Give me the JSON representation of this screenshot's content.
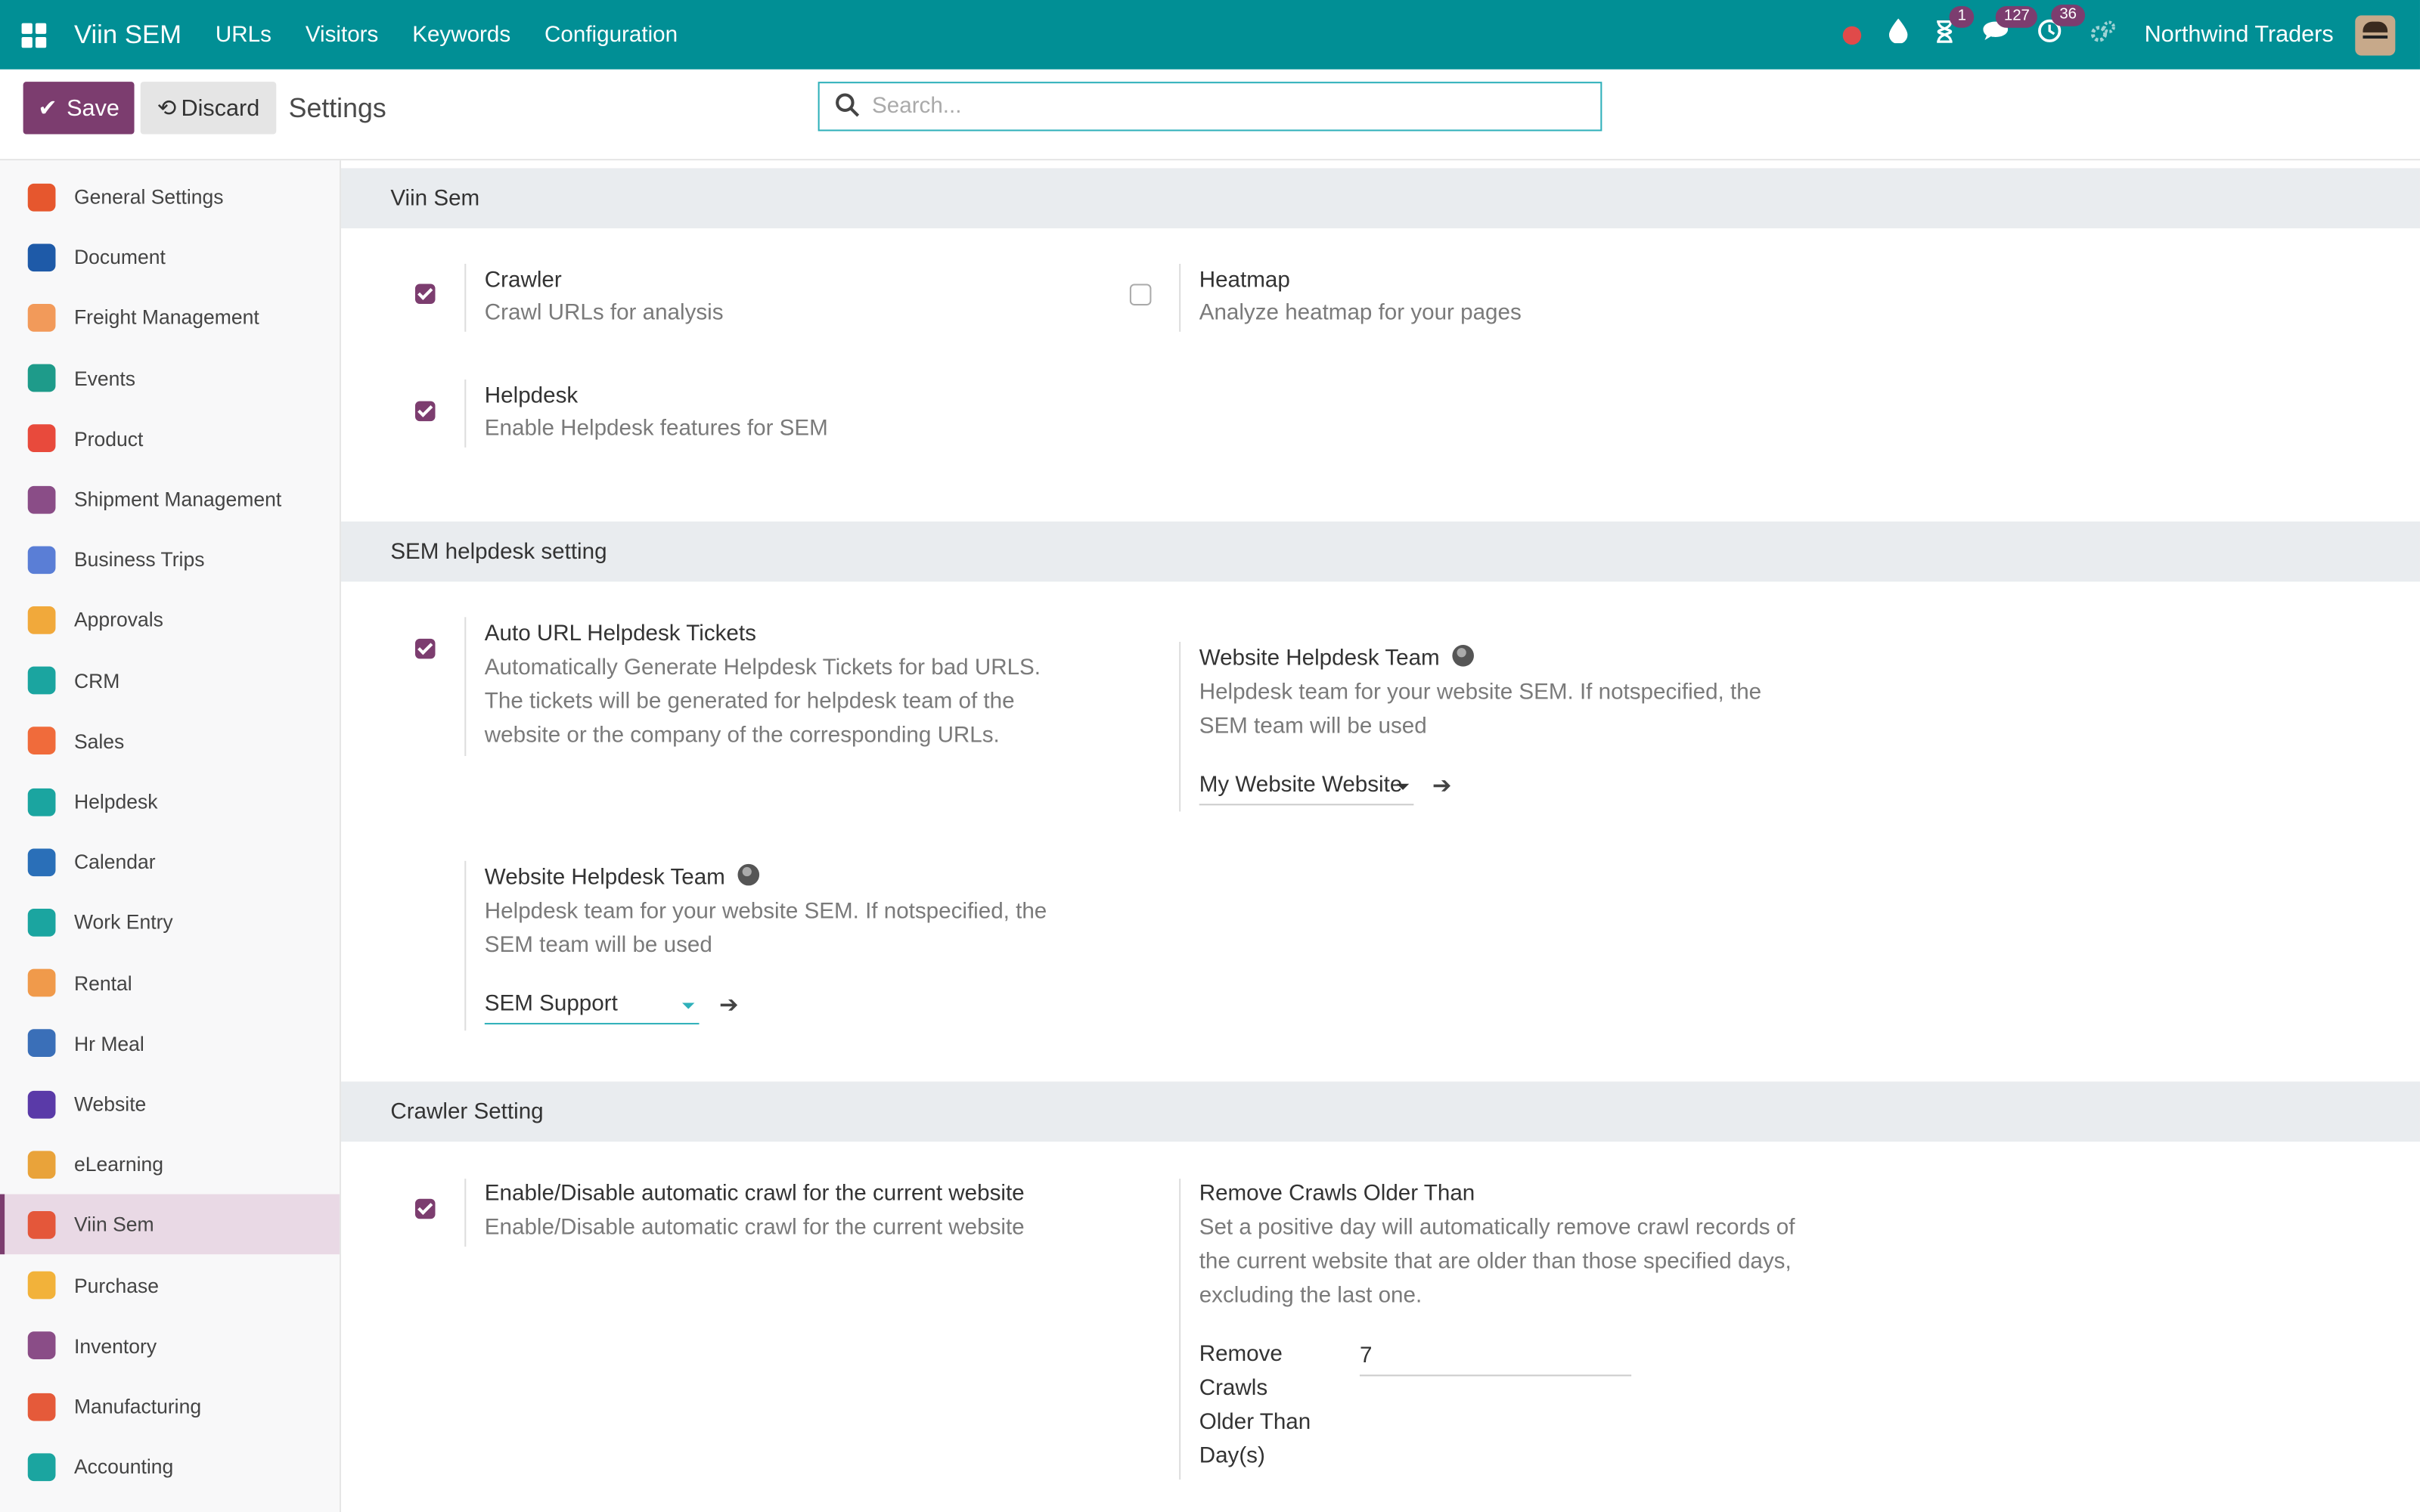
{
  "topbar": {
    "brand": "Viin SEM",
    "menu": [
      "URLs",
      "Visitors",
      "Keywords",
      "Configuration"
    ],
    "badges": {
      "activities": "1",
      "messages": "127",
      "clock": "36"
    },
    "company": "Northwind Traders"
  },
  "control": {
    "save_label": "Save",
    "discard_label": "Discard",
    "title": "Settings",
    "search_placeholder": "Search..."
  },
  "sidebar": {
    "items": [
      {
        "label": "General Settings",
        "color": "#e6572e"
      },
      {
        "label": "Document",
        "color": "#1e5aa8"
      },
      {
        "label": "Freight Management",
        "color": "#f29a5a"
      },
      {
        "label": "Events",
        "color": "#1e9b8a"
      },
      {
        "label": "Product",
        "color": "#e84a3c"
      },
      {
        "label": "Shipment Management",
        "color": "#8a4d87"
      },
      {
        "label": "Business Trips",
        "color": "#5a7ed6"
      },
      {
        "label": "Approvals",
        "color": "#f1a93b"
      },
      {
        "label": "CRM",
        "color": "#1ba5a0"
      },
      {
        "label": "Sales",
        "color": "#f06b3b"
      },
      {
        "label": "Helpdesk",
        "color": "#1ba5a0"
      },
      {
        "label": "Calendar",
        "color": "#2a6fb8"
      },
      {
        "label": "Work Entry",
        "color": "#1ba5a0"
      },
      {
        "label": "Rental",
        "color": "#f09a4b"
      },
      {
        "label": "Hr Meal",
        "color": "#3a6fb8"
      },
      {
        "label": "Website",
        "color": "#5a3aa8"
      },
      {
        "label": "eLearning",
        "color": "#e9a33a"
      },
      {
        "label": "Viin Sem",
        "color": "#e4573a"
      },
      {
        "label": "Purchase",
        "color": "#f2b23a"
      },
      {
        "label": "Inventory",
        "color": "#8a4d87"
      },
      {
        "label": "Manufacturing",
        "color": "#e55a3a"
      },
      {
        "label": "Accounting",
        "color": "#1ba5a0"
      }
    ],
    "active_index": 17
  },
  "sections": {
    "viin_sem": {
      "title": "Viin Sem",
      "crawler_label": "Crawler",
      "crawler_desc": "Crawl URLs for analysis",
      "heatmap_label": "Heatmap",
      "heatmap_desc": "Analyze heatmap for your pages",
      "helpdesk_label": "Helpdesk",
      "helpdesk_desc": "Enable Helpdesk features for SEM"
    },
    "helpdesk_setting": {
      "title": "SEM helpdesk setting",
      "auto_label": "Auto URL Helpdesk Tickets",
      "auto_desc": "Automatically Generate Helpdesk Tickets for bad URLS. The tickets will be generated for helpdesk team of the website or the company of the corresponding URLs.",
      "team_label": "Website Helpdesk Team",
      "team_desc": "Helpdesk team for your website SEM. If notspecified, the SEM team will be used",
      "team_value_right": "My Website Website",
      "team_value_left": "SEM Support"
    },
    "crawler_setting": {
      "title": "Crawler Setting",
      "auto_label": "Enable/Disable automatic crawl for the current website",
      "auto_desc": "Enable/Disable automatic crawl for the current website",
      "remove_label": "Remove Crawls Older Than",
      "remove_desc": "Set a positive day will automatically remove crawl records of the current website that are older than those specified days, excluding the last one.",
      "field_label": "Remove Crawls Older Than Day(s)",
      "field_value": "7"
    }
  }
}
